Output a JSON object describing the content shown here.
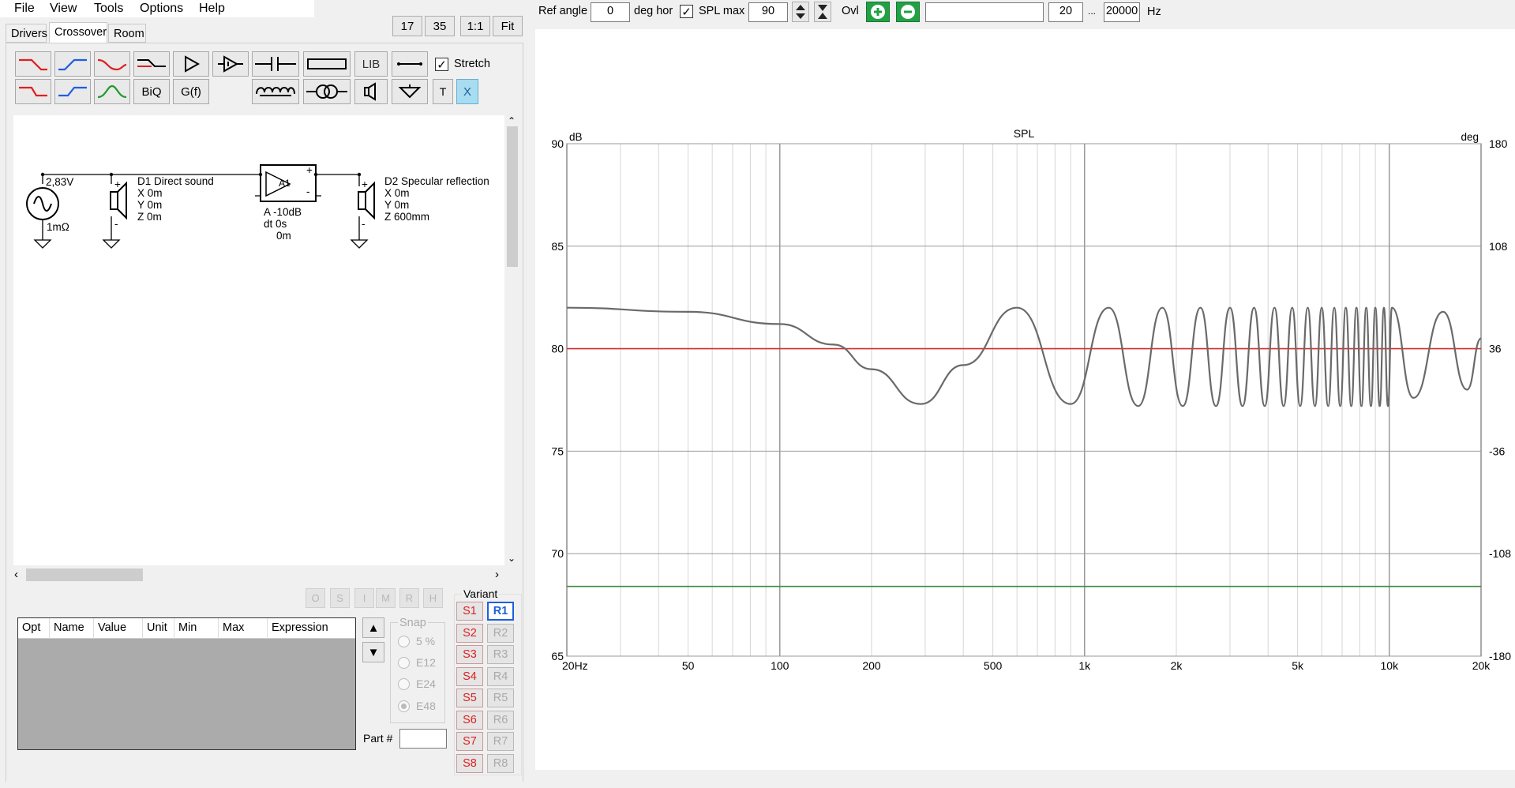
{
  "menu": [
    "File",
    "View",
    "Tools",
    "Options",
    "Help"
  ],
  "zoom_buttons": [
    "17",
    "35",
    "1:1",
    "Fit"
  ],
  "tabs": [
    "Drivers",
    "Crossover",
    "Room"
  ],
  "toolbar": {
    "lib_label": "LIB",
    "biq_label": "BiQ",
    "gf_label": "G(f)",
    "t_label": "T",
    "x_label": "X",
    "stretch_label": "Stretch",
    "stretch_checked": true
  },
  "schematic": {
    "source_voltage": "2,83V",
    "source_impedance": "1mΩ",
    "driver1": {
      "name": "D1 Direct sound",
      "x": "X 0m",
      "y": "Y 0m",
      "z": "Z 0m"
    },
    "amp": {
      "label": "A1",
      "gain": "A -10dB",
      "dt": "dt 0s",
      "offset": "0m"
    },
    "driver2": {
      "name": "D2 Specular reflection",
      "x": "X 0m",
      "y": "Y 0m",
      "z": "Z 600mm"
    },
    "plus": "+",
    "minus": "-"
  },
  "opt_buttons": [
    "O",
    "S",
    "I",
    "M",
    "R",
    "H"
  ],
  "table": {
    "headers": [
      "Opt",
      "Name",
      "Value",
      "Unit",
      "Min",
      "Max",
      "Expression"
    ]
  },
  "snap": {
    "title": "Snap",
    "options": [
      "5 %",
      "E12",
      "E24",
      "E48"
    ],
    "selected": "E48"
  },
  "part_label": "Part #",
  "variant": {
    "title": "Variant",
    "s": [
      "S1",
      "S2",
      "S3",
      "S4",
      "S5",
      "S6",
      "S7",
      "S8"
    ],
    "r": [
      "R1",
      "R2",
      "R3",
      "R4",
      "R5",
      "R6",
      "R7",
      "R8"
    ],
    "active_r": "R1"
  },
  "topbar": {
    "ref_angle_label": "Ref angle",
    "ref_angle_value": "0",
    "deg_hor_label": "deg hor",
    "spl_max_label": "SPL max",
    "spl_max_checked": true,
    "spl_max_value": "90",
    "ovl_label": "Ovl",
    "text_field": "",
    "f_min": "20",
    "ellipsis": "...",
    "f_max": "20000",
    "hz_label": "Hz"
  },
  "chart_data": {
    "type": "line",
    "title": "SPL",
    "ylabel_left": "dB",
    "ylabel_right": "deg",
    "xscale": "log",
    "xlim": [
      20,
      20000
    ],
    "ylim": [
      65,
      90
    ],
    "ylim_right": [
      -180,
      180
    ],
    "x_ticks": [
      20,
      50,
      100,
      200,
      500,
      1000,
      2000,
      5000,
      10000,
      20000
    ],
    "x_tick_labels": [
      "20Hz",
      "50",
      "100",
      "200",
      "500",
      "1k",
      "2k",
      "5k",
      "10k",
      "20k"
    ],
    "y_ticks": [
      65,
      70,
      75,
      80,
      85,
      90
    ],
    "y_tick_labels": [
      "65",
      "70",
      "75",
      "80",
      "85",
      "90"
    ],
    "y_right_tick_labels": [
      "-180",
      "-108",
      "-36",
      "36",
      "108",
      "180"
    ],
    "grid": true,
    "series": [
      {
        "color": "#6a6a6a",
        "description": "direct + reflection interference",
        "x": [
          20,
          50,
          100,
          150,
          200,
          290,
          400,
          600,
          900,
          1200,
          1500,
          1800,
          2100,
          2400,
          2700,
          3000,
          3300,
          3600,
          3900,
          4200,
          4500,
          4800,
          5100,
          5400,
          5700,
          6000,
          6300,
          6600,
          6900,
          7200,
          7500,
          7800,
          8100,
          8400,
          8700,
          9000,
          9300,
          9600,
          9900,
          10200,
          12000,
          15000,
          18000,
          20000
        ],
        "y": [
          82,
          81.8,
          81.2,
          80.2,
          79,
          77.3,
          79.2,
          82,
          77.3,
          82,
          77.2,
          82,
          77.2,
          82,
          77.2,
          82,
          77.2,
          82,
          77.2,
          82,
          77.2,
          82,
          77.2,
          82,
          77.2,
          82,
          77.2,
          82,
          77.2,
          82,
          77.2,
          82,
          77.2,
          82,
          77.2,
          82,
          77.2,
          82,
          77.2,
          82,
          77.6,
          81.8,
          78,
          80.5
        ]
      },
      {
        "color": "#d23030",
        "description": "reference 80 dB",
        "x": [
          20,
          20000
        ],
        "y": [
          80,
          80
        ]
      },
      {
        "color": "#3a8a3a",
        "description": "reference line",
        "x": [
          20,
          20000
        ],
        "y": [
          68.4,
          68.4
        ]
      }
    ]
  }
}
